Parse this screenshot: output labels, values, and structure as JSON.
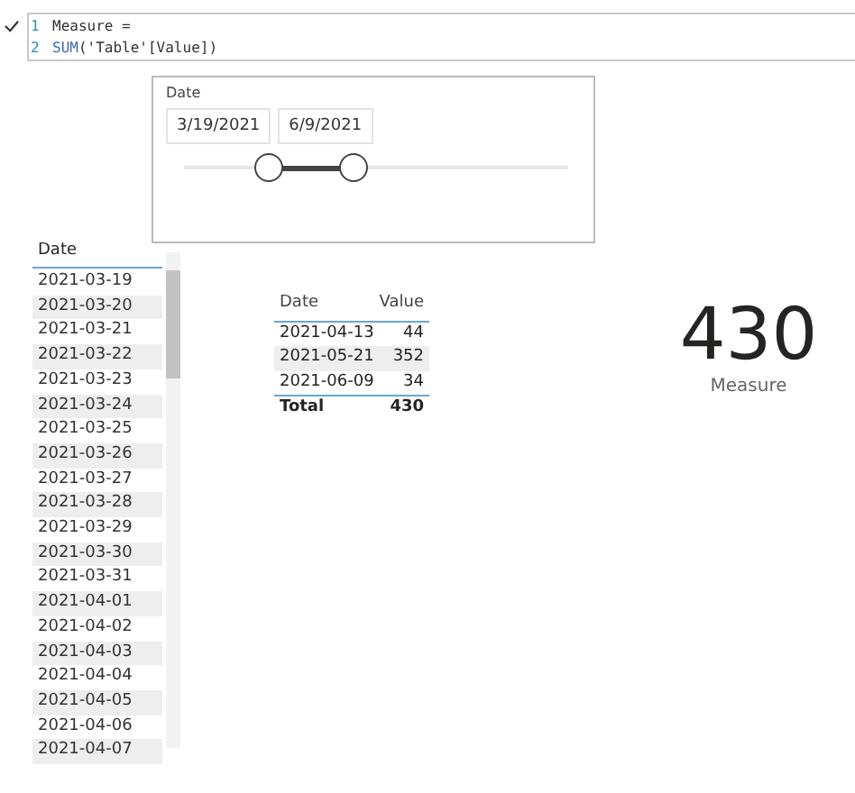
{
  "formula": {
    "lines": [
      {
        "number": "1",
        "text": "Measure ="
      },
      {
        "number": "2",
        "func": "SUM",
        "text": "('Table'[Value])"
      }
    ]
  },
  "slicer": {
    "title": "Date",
    "start": "3/19/2021",
    "end": "6/9/2021",
    "handles": [
      {
        "level": 0.22
      },
      {
        "level": 0.44
      }
    ]
  },
  "date_list": {
    "header": "Date",
    "rows": [
      "2021-03-19",
      "2021-03-20",
      "2021-03-21",
      "2021-03-22",
      "2021-03-23",
      "2021-03-24",
      "2021-03-25",
      "2021-03-26",
      "2021-03-27",
      "2021-03-28",
      "2021-03-29",
      "2021-03-30",
      "2021-03-31",
      "2021-04-01",
      "2021-04-02",
      "2021-04-03",
      "2021-04-04",
      "2021-04-05",
      "2021-04-06",
      "2021-04-07"
    ]
  },
  "table": {
    "columns": [
      "Date",
      "Value"
    ],
    "rows": [
      [
        "2021-04-13",
        "44"
      ],
      [
        "2021-05-21",
        "352"
      ],
      [
        "2021-06-09",
        "34"
      ]
    ],
    "total": [
      "Total",
      "430"
    ]
  },
  "card": {
    "value": "430",
    "label": "Measure"
  }
}
